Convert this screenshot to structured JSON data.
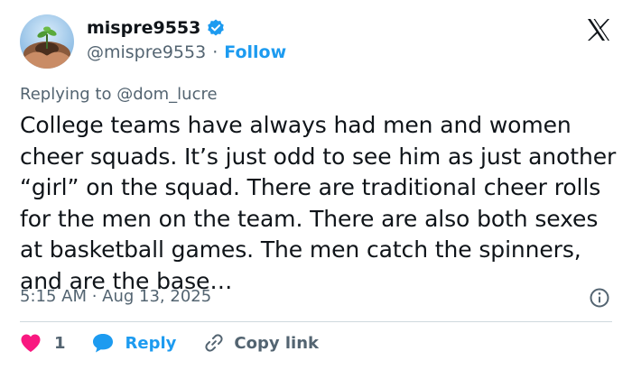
{
  "author": {
    "display_name": "mispre9553",
    "handle": "@mispre9553",
    "separator": "·",
    "follow_label": "Follow"
  },
  "reply_to": {
    "prefix": "Replying to ",
    "mention": "@dom_lucre"
  },
  "tweet": {
    "text": "College teams have always had men and women cheer squads. It’s just odd to see him as just another “girl” on the squad. There are traditional cheer rolls for the men on the team. There are also both sexes at basketball games. The men catch the spinners, and are the base…",
    "timestamp": "5:15 AM · Aug 13, 2025"
  },
  "actions": {
    "like_count": "1",
    "reply_label": "Reply",
    "copy_label": "Copy link"
  },
  "icons": {
    "verified": "verified-badge-icon",
    "logo": "x-logo-icon",
    "info": "info-icon",
    "like": "heart-icon",
    "reply": "speech-bubble-icon",
    "copy": "link-icon"
  },
  "colors": {
    "accent": "#1d9bf0",
    "like": "#f91880",
    "text": "#0f1419",
    "muted": "#536471",
    "divider": "#cfd9de"
  }
}
